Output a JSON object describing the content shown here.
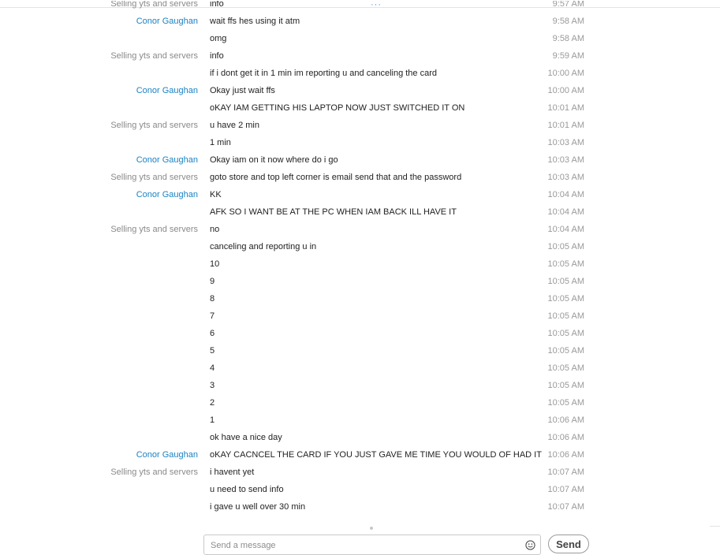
{
  "messages": [
    {
      "sender": "Selling yts and servers",
      "text": "info",
      "time": "9:57 AM",
      "kind": "seller"
    },
    {
      "sender": "Conor Gaughan",
      "text": "wait ffs hes using it atm",
      "time": "9:58 AM",
      "kind": "conor"
    },
    {
      "sender": "",
      "text": "omg",
      "time": "9:58 AM",
      "kind": "conor"
    },
    {
      "sender": "Selling yts and servers",
      "text": "info",
      "time": "9:59 AM",
      "kind": "seller"
    },
    {
      "sender": "",
      "text": "if i dont get it in 1 min im reporting u and canceling the card",
      "time": "10:00 AM",
      "kind": "seller"
    },
    {
      "sender": "Conor Gaughan",
      "text": "Okay just wait ffs",
      "time": "10:00 AM",
      "kind": "conor"
    },
    {
      "sender": "",
      "text": "oKAY IAM GETTING HIS LAPTOP NOW JUST SWITCHED IT ON",
      "time": "10:01 AM",
      "kind": "conor"
    },
    {
      "sender": "Selling yts and servers",
      "text": "u have 2 min",
      "time": "10:01 AM",
      "kind": "seller"
    },
    {
      "sender": "",
      "text": "1 min",
      "time": "10:03 AM",
      "kind": "seller"
    },
    {
      "sender": "Conor Gaughan",
      "text": "Okay iam on it now where do i go",
      "time": "10:03 AM",
      "kind": "conor"
    },
    {
      "sender": "Selling yts and servers",
      "text": "goto store and top left corner is email send that and the password",
      "time": "10:03 AM",
      "kind": "seller"
    },
    {
      "sender": "Conor Gaughan",
      "text": "KK",
      "time": "10:04 AM",
      "kind": "conor"
    },
    {
      "sender": "",
      "text": "AFK SO I WANT BE AT THE PC WHEN IAM BACK ILL HAVE IT",
      "time": "10:04 AM",
      "kind": "conor"
    },
    {
      "sender": "Selling yts and servers",
      "text": "no",
      "time": "10:04 AM",
      "kind": "seller"
    },
    {
      "sender": "",
      "text": "canceling and reporting u in",
      "time": "10:05 AM",
      "kind": "seller"
    },
    {
      "sender": "",
      "text": "10",
      "time": "10:05 AM",
      "kind": "seller"
    },
    {
      "sender": "",
      "text": "9",
      "time": "10:05 AM",
      "kind": "seller"
    },
    {
      "sender": "",
      "text": "8",
      "time": "10:05 AM",
      "kind": "seller"
    },
    {
      "sender": "",
      "text": "7",
      "time": "10:05 AM",
      "kind": "seller"
    },
    {
      "sender": "",
      "text": "6",
      "time": "10:05 AM",
      "kind": "seller"
    },
    {
      "sender": "",
      "text": "5",
      "time": "10:05 AM",
      "kind": "seller"
    },
    {
      "sender": "",
      "text": "4",
      "time": "10:05 AM",
      "kind": "seller"
    },
    {
      "sender": "",
      "text": "3",
      "time": "10:05 AM",
      "kind": "seller"
    },
    {
      "sender": "",
      "text": "2",
      "time": "10:05 AM",
      "kind": "seller"
    },
    {
      "sender": "",
      "text": "1",
      "time": "10:06 AM",
      "kind": "seller"
    },
    {
      "sender": "",
      "text": "ok have a nice day",
      "time": "10:06 AM",
      "kind": "seller"
    },
    {
      "sender": "Conor Gaughan",
      "text": "oKAY CACNCEL THE CARD IF YOU JUST GAVE ME TIME YOU WOULD OF HAD IT",
      "time": "10:06 AM",
      "kind": "conor"
    },
    {
      "sender": "Selling yts and servers",
      "text": "i havent yet",
      "time": "10:07 AM",
      "kind": "seller"
    },
    {
      "sender": "",
      "text": "u need to send info",
      "time": "10:07 AM",
      "kind": "seller"
    },
    {
      "sender": "",
      "text": "i gave u well over 30 min",
      "time": "10:07 AM",
      "kind": "seller"
    }
  ],
  "composer": {
    "placeholder": "Send a message",
    "send_label": "Send",
    "emoji_icon": "smiley-icon"
  },
  "colors": {
    "seller_name": "#8a8a8a",
    "conor_name": "#1a82c4",
    "timestamp": "#9a9a9a",
    "text": "#222222"
  }
}
